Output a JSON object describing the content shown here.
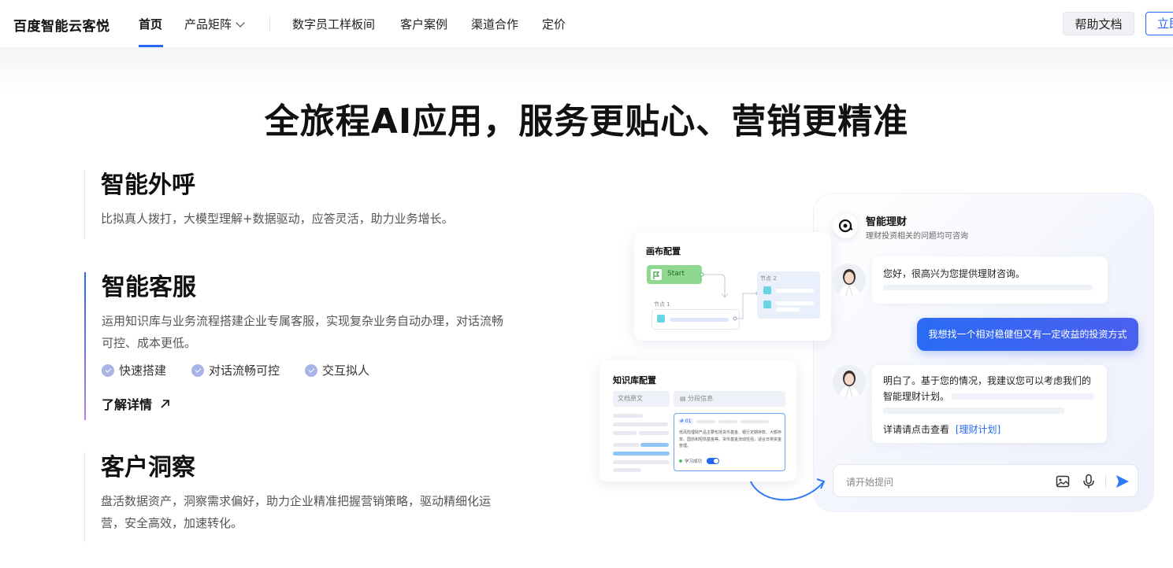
{
  "header": {
    "brand": "百度智能云客悦",
    "nav": [
      {
        "label": "首页",
        "active": true
      },
      {
        "label": "产品矩阵",
        "has_dropdown": true
      },
      {
        "label": "数字员工样板间"
      },
      {
        "label": "客户案例"
      },
      {
        "label": "渠道合作"
      },
      {
        "label": "定价"
      }
    ],
    "help_button": "帮助文档",
    "cta_button": "立即"
  },
  "hero": {
    "headline": "全旅程AI应用，服务更贴心、营销更精准"
  },
  "features": [
    {
      "title": "智能外呼",
      "desc": "比拟真人拨打，大模型理解+数据驱动，应答灵活，助力业务增长。"
    },
    {
      "title": "智能客服",
      "desc": "运用知识库与业务流程搭建企业专属客服，实现复杂业务自动办理，对话流畅可控、成本更低。",
      "tags": [
        "快速搭建",
        "对话流畅可控",
        "交互拟人"
      ],
      "more": "了解详情"
    },
    {
      "title": "客户洞察",
      "desc": "盘活数据资产，洞察需求偏好，助力企业精准把握营销策略，驱动精细化运营，安全高效，加速转化。"
    }
  ],
  "illustration": {
    "canvas_card": {
      "title": "画布配置",
      "start": "Start",
      "node1": "节点 1",
      "node2": "节点 2"
    },
    "kb_card": {
      "title": "知识库配置",
      "tab1": "文档原文",
      "tab2": "分段信息",
      "seg_id": "# 01",
      "seg_text": "低风险理财产品主要包括货币基金、银行定期存款、大额存单、国债和短债基金等。货币基金流动性强，适合日常资金管理。",
      "status": "学习成功"
    },
    "chat": {
      "title": "智能理财",
      "subtitle": "理财投资相关的问题均可咨询",
      "bot_msg1": "您好，很高兴为您提供理财咨询。",
      "user_msg": "我想找一个相对稳健但又有一定收益的投资方式",
      "bot_msg2": "明白了。基于您的情况，我建议您可以考虑我们的智能理财计划。",
      "detail_prefix": "详请请点击查看",
      "detail_link": "[理财计划]",
      "input_placeholder": "请开始提问"
    },
    "colors": {
      "accent": "#2468f2",
      "green": "#4cc26a"
    }
  }
}
